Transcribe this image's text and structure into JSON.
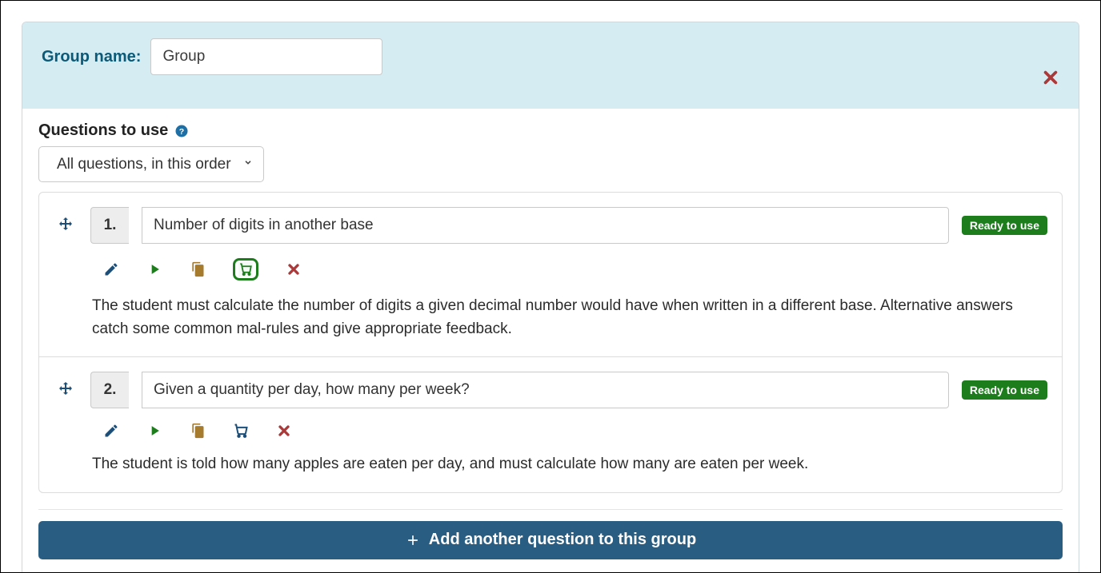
{
  "group": {
    "name_label": "Group name:",
    "name_value": "Group"
  },
  "questions_section": {
    "label": "Questions to use",
    "order_selected": "All questions, in this order"
  },
  "questions": [
    {
      "num": "1.",
      "title": "Number of digits in another base",
      "status": "Ready to use",
      "in_basket": true,
      "description": "The student must calculate the number of digits a given decimal number would have when written in a different base. Alternative answers catch some common mal-rules and give appropriate feedback."
    },
    {
      "num": "2.",
      "title": "Given a quantity per day, how many per week?",
      "status": "Ready to use",
      "in_basket": false,
      "description": "The student is told how many apples are eaten per day, and must calculate how many are eaten per week."
    }
  ],
  "footer": {
    "add_label": "Add another question to this group"
  }
}
